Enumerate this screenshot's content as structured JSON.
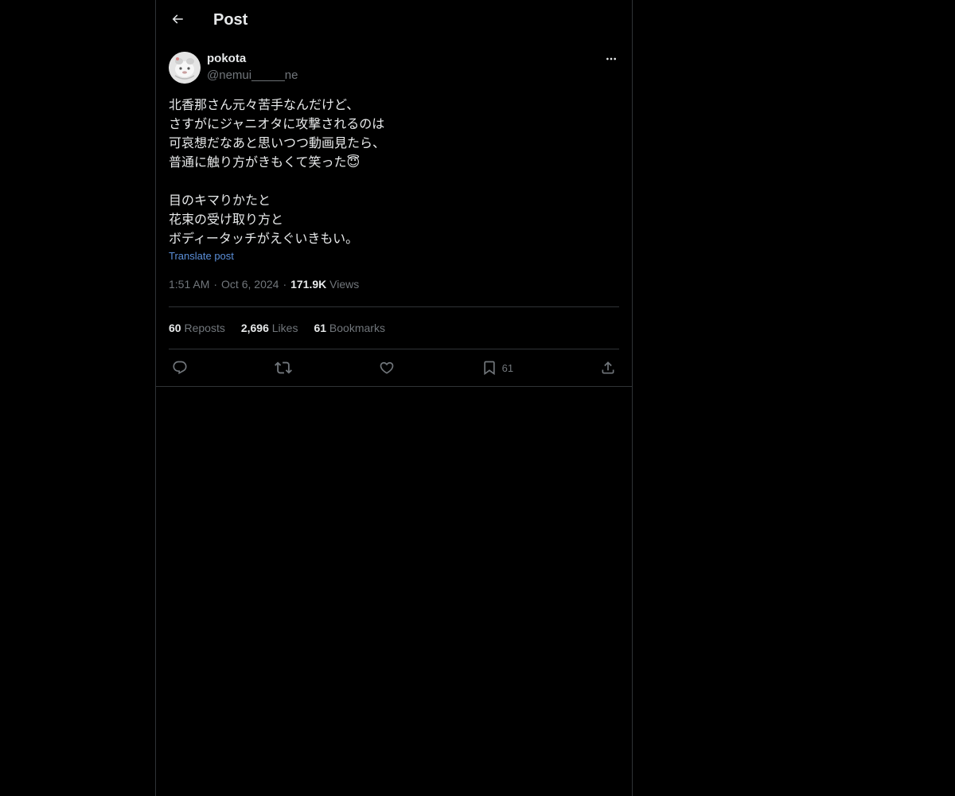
{
  "header": {
    "title": "Post",
    "back_icon": "arrow-left-icon"
  },
  "post": {
    "author_name": "pokota",
    "author_handle": "@nemui_____ne",
    "text": "北香那さん元々苦手なんだけど、\nさすがにジャニオタに攻撃されるのは\n可哀想だなあと思いつつ動画見たら、\n普通に触り方がきもくて笑った😇\n\n目のキマりかたと\n花束の受け取り方と\nボディータッチがえぐいきもい。",
    "translate_label": "Translate post",
    "time": "1:51 AM",
    "date": "Oct 6, 2024",
    "views_count": "171.9K",
    "views_label": "Views",
    "dot": "·"
  },
  "stats": {
    "reposts_count": "60",
    "reposts_label": "Reposts",
    "likes_count": "2,696",
    "likes_label": "Likes",
    "bookmarks_count": "61",
    "bookmarks_label": "Bookmarks"
  },
  "actions": {
    "bookmark_count": "61"
  },
  "colors": {
    "background": "#000000",
    "text_primary": "#e7e9ea",
    "text_secondary": "#71767b",
    "link": "#5b8fd9",
    "border": "#2f3336"
  }
}
